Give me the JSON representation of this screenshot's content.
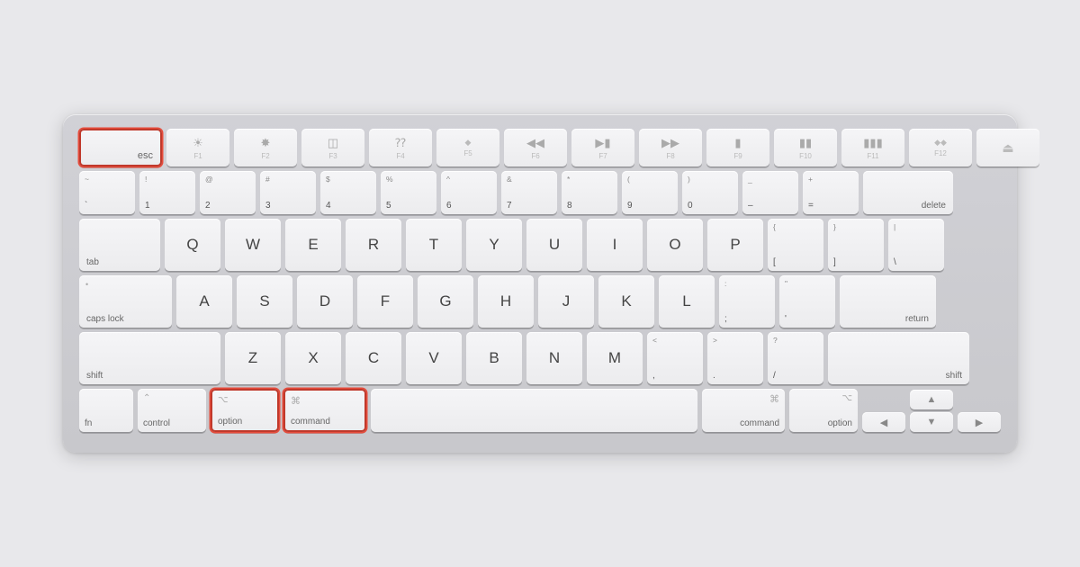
{
  "keyboard": {
    "highlighted_keys": [
      "esc",
      "option-left",
      "command-left"
    ],
    "rows": {
      "fn_row": {
        "keys": [
          {
            "id": "esc",
            "label": "esc",
            "highlighted": true
          },
          {
            "id": "f1",
            "icon": "☼",
            "label": "F1"
          },
          {
            "id": "f2",
            "icon": "✦",
            "label": "F2"
          },
          {
            "id": "f3",
            "icon": "⊞",
            "label": "F3"
          },
          {
            "id": "f4",
            "icon": "⊟",
            "label": "F4"
          },
          {
            "id": "f5",
            "icon": "",
            "label": "F5"
          },
          {
            "id": "f6",
            "icon": "⏮",
            "label": "F6"
          },
          {
            "id": "f7",
            "icon": "⏯",
            "label": "F7"
          },
          {
            "id": "f8",
            "icon": "⏭",
            "label": "F8"
          },
          {
            "id": "f9",
            "icon": "🔇",
            "label": "F9"
          },
          {
            "id": "f10",
            "icon": "🔉",
            "label": "F10"
          },
          {
            "id": "f11",
            "icon": "🔊",
            "label": "F11"
          },
          {
            "id": "f12",
            "icon": "",
            "label": "F12"
          },
          {
            "id": "eject",
            "icon": "⏏",
            "label": ""
          }
        ]
      },
      "number_row": {
        "keys": [
          {
            "top": "~",
            "main": "`"
          },
          {
            "top": "!",
            "main": "1"
          },
          {
            "top": "@",
            "main": "2"
          },
          {
            "top": "#",
            "main": "3"
          },
          {
            "top": "$",
            "main": "4"
          },
          {
            "top": "%",
            "main": "5"
          },
          {
            "top": "^",
            "main": "6"
          },
          {
            "top": "&",
            "main": "7"
          },
          {
            "top": "*",
            "main": "8"
          },
          {
            "top": "(",
            "main": "9"
          },
          {
            "top": ")",
            "main": "0"
          },
          {
            "top": "_",
            "main": "–"
          },
          {
            "top": "+",
            "main": "="
          }
        ]
      },
      "alpha_rows": {
        "row1": [
          "Q",
          "W",
          "E",
          "R",
          "T",
          "Y",
          "U",
          "I",
          "O",
          "P"
        ],
        "row2": [
          "A",
          "S",
          "D",
          "F",
          "G",
          "H",
          "J",
          "K",
          "L"
        ],
        "row3": [
          "Z",
          "X",
          "C",
          "V",
          "B",
          "N",
          "M"
        ]
      }
    }
  }
}
